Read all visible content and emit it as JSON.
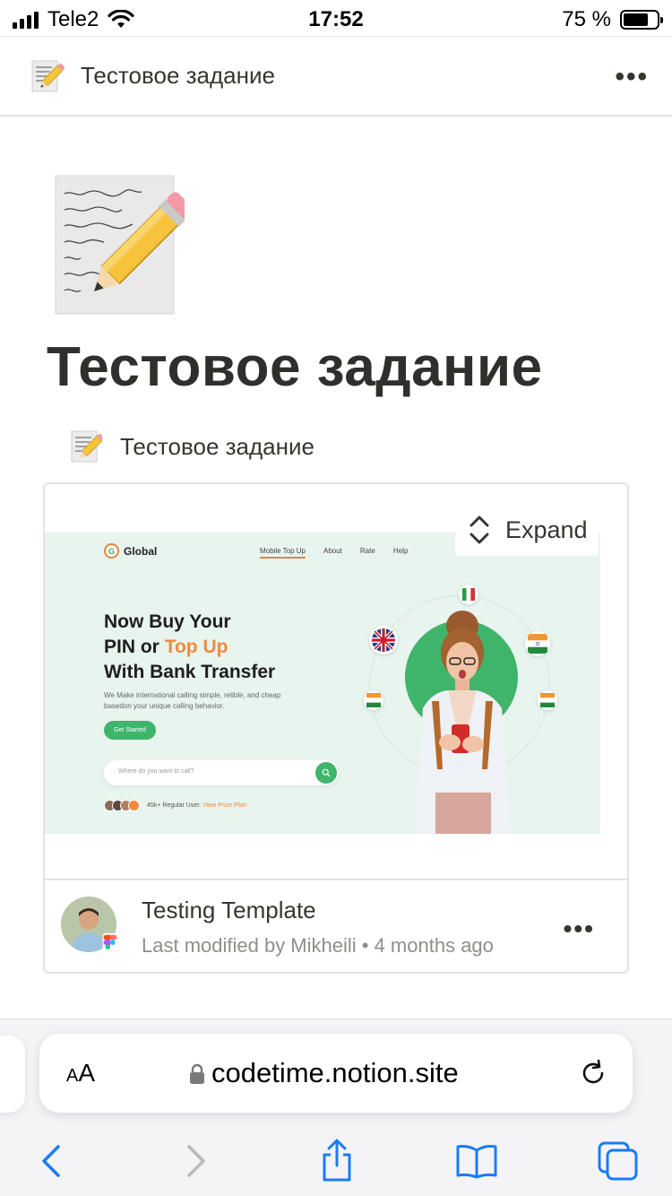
{
  "status_bar": {
    "carrier": "Tele2",
    "time": "17:52",
    "battery_percent": "75 %",
    "battery_level": 0.75
  },
  "topbar": {
    "title": "Тестовое задание",
    "more": "•••"
  },
  "page": {
    "title": "Тестовое задание",
    "subpage_link": "Тестовое задание"
  },
  "embed": {
    "expand_label": "Expand",
    "title": "Testing Template",
    "meta": "Last modified by Mikheili • 4 months ago",
    "more": "•••",
    "preview": {
      "logo": "Global",
      "nav": [
        "Mobile Top Up",
        "About",
        "Rate",
        "Help"
      ],
      "headline_1": "Now Buy Your",
      "headline_2a": "PIN or ",
      "headline_2b": "Top Up",
      "headline_3": "With Bank Transfer",
      "description_1": "We Make international calling simple, relible, and cheap",
      "description_2": "basedon your unique calling behavior.",
      "cta": "Get Started",
      "search_placeholder": "Where do you want to call?",
      "users_text": "45k+ Regular User.",
      "users_link": "View Price Plan"
    }
  },
  "browser": {
    "aa_label_small": "A",
    "aa_label_large": "A",
    "url": "codetime.notion.site"
  },
  "colors": {
    "accent_blue": "#1a7cf5",
    "landing_green": "#3fb46b",
    "landing_orange": "#f08a3c"
  }
}
